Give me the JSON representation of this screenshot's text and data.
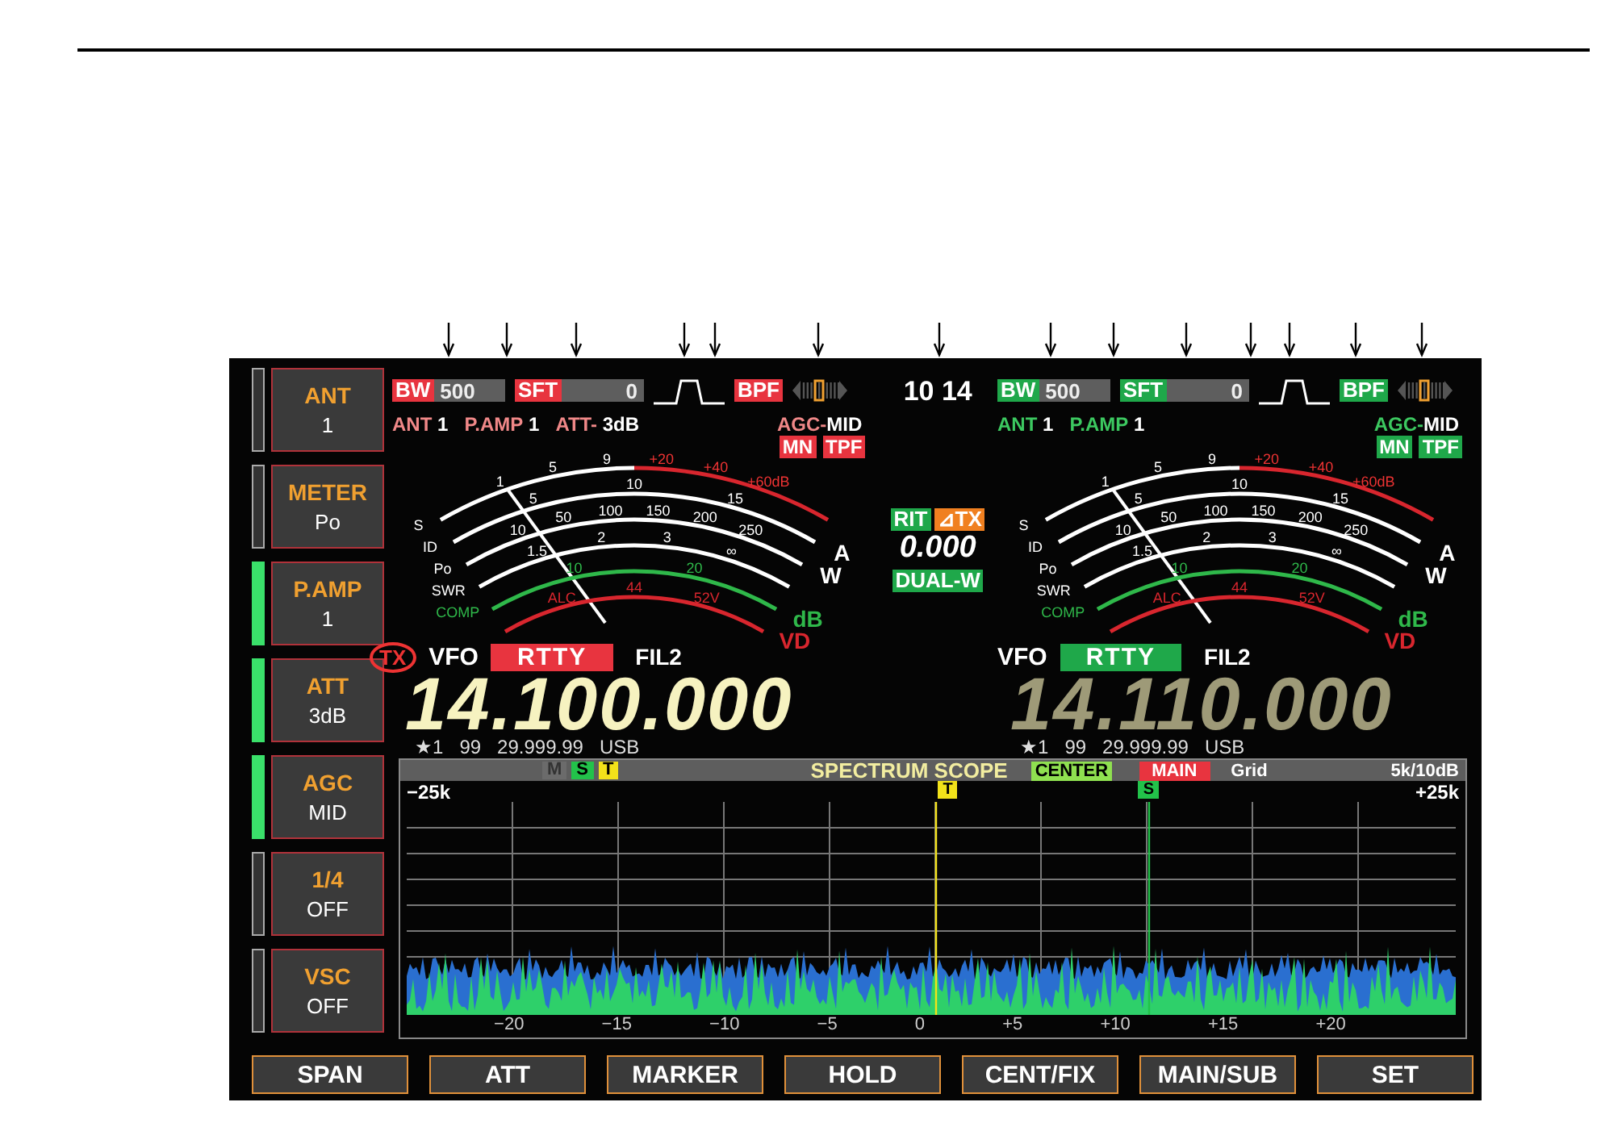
{
  "side_buttons": [
    {
      "label": "ANT",
      "value": "1",
      "on": false
    },
    {
      "label": "METER",
      "value": "Po",
      "on": false
    },
    {
      "label": "P.AMP",
      "value": "1",
      "on": true
    },
    {
      "label": "ATT",
      "value": "3dB",
      "on": true
    },
    {
      "label": "AGC",
      "value": "MID",
      "on": true
    },
    {
      "label": "1/4",
      "value": "OFF",
      "on": false
    },
    {
      "label": "VSC",
      "value": "OFF",
      "on": false
    }
  ],
  "receivers": [
    {
      "selected": true,
      "color": "#e8343f",
      "bw_label": "BW",
      "bw_value": "500",
      "sft_label": "SFT",
      "sft_value": "0",
      "bpf": "BPF",
      "settings": [
        {
          "label": "ANT",
          "value": "1"
        },
        {
          "label": "P.AMP",
          "value": "1"
        },
        {
          "label": "ATT-",
          "value": "3dB"
        }
      ],
      "agc_label": "AGC-",
      "agc_value": "MID",
      "tags": [
        "MN",
        "TPF"
      ],
      "meter": {
        "arcs": [
          {
            "start": "S",
            "labels": [
              "1",
              "5",
              "9"
            ],
            "over": [
              "+20",
              "+40",
              "+60dB"
            ],
            "color": "#ffffff"
          },
          {
            "start": "ID",
            "labels": [
              "5",
              "10",
              "15"
            ],
            "end": "A",
            "color": "#ffffff"
          },
          {
            "start": "Po",
            "labels": [
              "10",
              "50",
              "100",
              "150",
              "200",
              "250"
            ],
            "end": "W",
            "color": "#ffffff"
          },
          {
            "start": "SWR",
            "labels": [
              "1.5",
              "2",
              "3",
              "∞"
            ],
            "color": "#ffffff"
          },
          {
            "start": "COMP",
            "labels": [
              "10",
              "20"
            ],
            "end": "dB",
            "color": "#2fb84a"
          },
          {
            "labels": [
              "ALC",
              "44",
              "52V"
            ],
            "end": "VD",
            "color": "#d8262e"
          }
        ]
      },
      "tx": "TX",
      "vfo": "VFO",
      "mode": "RTTY",
      "filter": "FIL2",
      "frequency": "14.100.000",
      "memory": [
        "★1",
        "99",
        "29.999.99",
        "USB"
      ]
    },
    {
      "selected": false,
      "color": "#1fa84a",
      "bw_label": "BW",
      "bw_value": "500",
      "sft_label": "SFT",
      "sft_value": "0",
      "bpf": "BPF",
      "settings": [
        {
          "label": "ANT",
          "value": "1"
        },
        {
          "label": "P.AMP",
          "value": "1"
        }
      ],
      "agc_label": "AGC-",
      "agc_value": "MID",
      "tags": [
        "MN",
        "TPF"
      ],
      "meter": {
        "arcs": [
          {
            "start": "S",
            "labels": [
              "1",
              "5",
              "9"
            ],
            "over": [
              "+20",
              "+40",
              "+60dB"
            ],
            "color": "#ffffff"
          },
          {
            "start": "ID",
            "labels": [
              "5",
              "10",
              "15"
            ],
            "end": "A",
            "color": "#ffffff"
          },
          {
            "start": "Po",
            "labels": [
              "10",
              "50",
              "100",
              "150",
              "200",
              "250"
            ],
            "end": "W",
            "color": "#ffffff"
          },
          {
            "start": "SWR",
            "labels": [
              "1.5",
              "2",
              "3",
              "∞"
            ],
            "color": "#ffffff"
          },
          {
            "start": "COMP",
            "labels": [
              "10",
              "20"
            ],
            "end": "dB",
            "color": "#2fb84a"
          },
          {
            "labels": [
              "ALC",
              "44",
              "52V"
            ],
            "end": "VD",
            "color": "#d8262e"
          }
        ]
      },
      "vfo": "VFO",
      "mode": "RTTY",
      "filter": "FIL2",
      "frequency": "14.110.000",
      "memory": [
        "★1",
        "99",
        "29.999.99",
        "USB"
      ]
    }
  ],
  "center": {
    "clock": "10 14",
    "rit": "RIT",
    "delta_tx": "⊿TX",
    "rit_value": "0.000",
    "dual": "DUAL-W"
  },
  "spectrum": {
    "marker_tags": [
      {
        "text": "M",
        "color": "#6b6b6b",
        "on": false
      },
      {
        "text": "S",
        "color": "#22c24a",
        "on": true
      },
      {
        "text": "T",
        "color": "#f2e21a",
        "on": true
      }
    ],
    "title": "SPECTRUM SCOPE",
    "center": "CENTER",
    "main": "MAIN",
    "grid": "Grid",
    "scale": "5k/10dB",
    "left_span": "−25k",
    "right_span": "+25k",
    "markers": [
      {
        "text": "T",
        "color": "#f2e21a"
      },
      {
        "text": "S",
        "color": "#22c24a"
      }
    ],
    "axis_labels": [
      "−20",
      "−15",
      "−10",
      "−5",
      "0",
      "+5",
      "+10",
      "+15",
      "+20"
    ]
  },
  "bottom_buttons": [
    "SPAN",
    "ATT",
    "MARKER",
    "HOLD",
    "CENT/FIX",
    "MAIN/SUB",
    "SET"
  ]
}
